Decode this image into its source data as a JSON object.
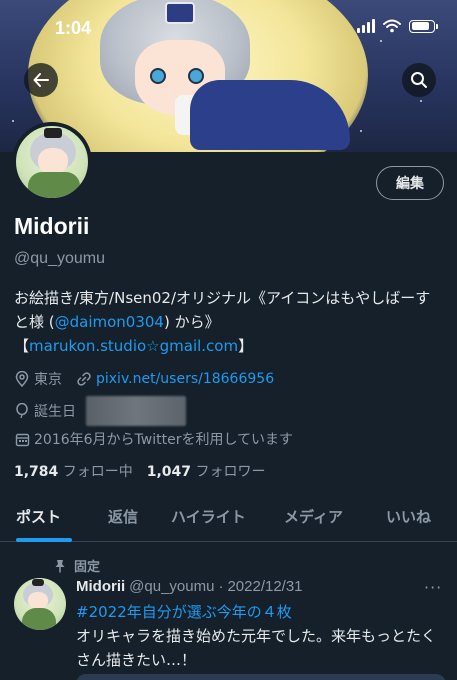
{
  "status_bar": {
    "time": "1:04",
    "battery_level": 0.85
  },
  "header": {
    "back_icon": "arrow-left-icon",
    "search_icon": "search-icon"
  },
  "profile": {
    "edit_label": "編集",
    "display_name": "Midorii",
    "handle": "@qu_youmu",
    "bio": {
      "line1_text": "お絵描き/東方/Nsen02/オリジナル《アイコンはもやしばーすと様 (",
      "mention": "@daimon0304",
      "line1_suffix": ") から》",
      "line2_prefix": "【",
      "email": "marukon.studio☆gmail.com",
      "line2_suffix": "】"
    },
    "location": "東京",
    "website": "pixiv.net/users/18666956",
    "birthday_label": "誕生日",
    "joined": "2016年6月からTwitterを利用しています",
    "following_count": "1,784",
    "following_label": "フォロー中",
    "followers_count": "1,047",
    "followers_label": "フォロワー"
  },
  "tabs": [
    {
      "label": "ポスト",
      "active": true
    },
    {
      "label": "返信",
      "active": false
    },
    {
      "label": "ハイライト",
      "active": false
    },
    {
      "label": "メディア",
      "active": false
    },
    {
      "label": "いいね",
      "active": false
    }
  ],
  "pinned_tweet": {
    "pinned_label": "固定",
    "author_name": "Midorii",
    "author_handle": "@qu_youmu",
    "separator": "·",
    "date": "2022/12/31",
    "hashtag": "#2022年自分が選ぶ今年の４枚",
    "text": "オリキャラを描き始めた元年でした。来年もっとたくさん描きたい…！",
    "more_label": "···"
  },
  "colors": {
    "background": "#15202b",
    "accent": "#1d9bf0",
    "secondary_text": "#8b98a5"
  }
}
